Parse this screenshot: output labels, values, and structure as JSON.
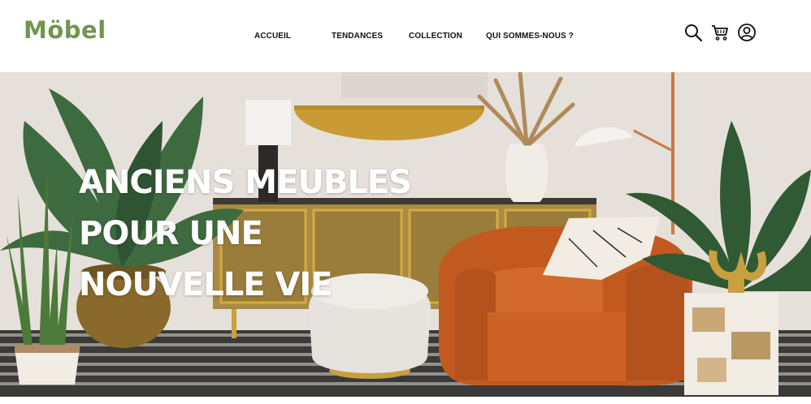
{
  "brand": {
    "logo": "Möbel",
    "color": "#6f9550"
  },
  "nav": {
    "items": [
      "ACCUEIL",
      "TENDANCES",
      "COLLECTION",
      "QUI SOMMES-NOUS ?"
    ]
  },
  "header_icons": [
    "search-icon",
    "cart-icon",
    "user-account-icon"
  ],
  "hero": {
    "headline_lines": [
      "ANCIENS MEUBLES",
      "POUR UNE",
      "NOUVELLE VIE"
    ]
  }
}
